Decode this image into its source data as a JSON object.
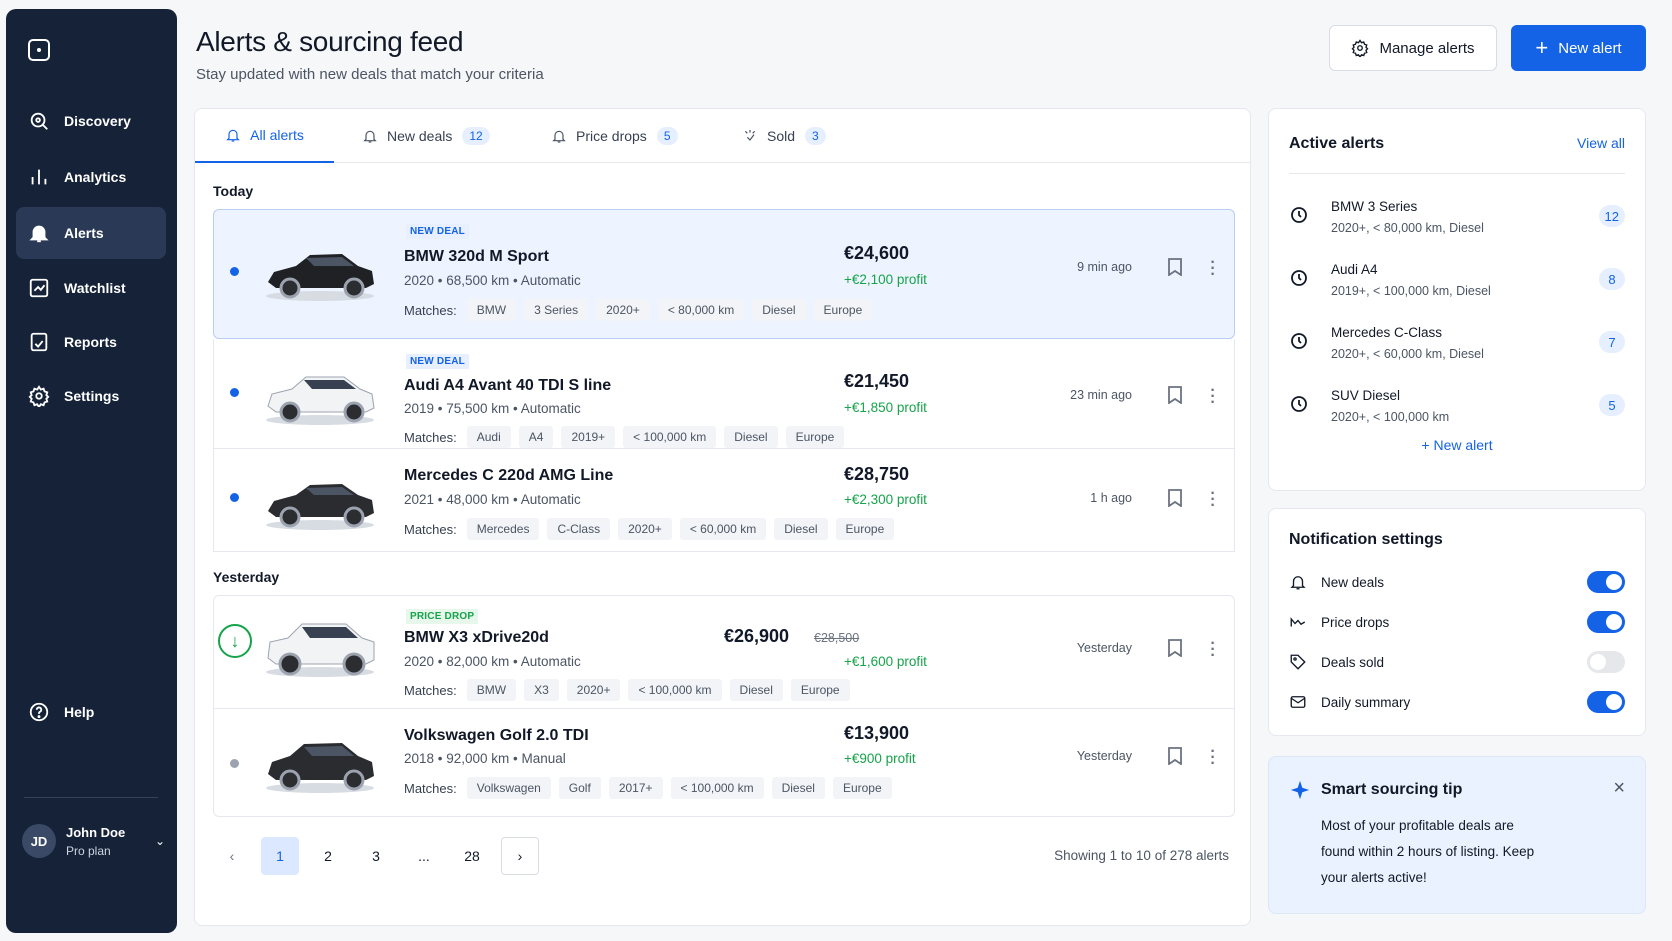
{
  "page": {
    "title": "Alerts & sourcing feed",
    "subtitle": "Stay updated with new deals that match your criteria",
    "manage_alerts": "Manage alerts",
    "new_alert": "New alert"
  },
  "sidebar": {
    "items": [
      {
        "label": "Discovery",
        "icon": "search-icon"
      },
      {
        "label": "Analytics",
        "icon": "bar-chart-icon"
      },
      {
        "label": "Alerts",
        "icon": "bell-icon",
        "active": true
      },
      {
        "label": "Watchlist",
        "icon": "chart-icon"
      },
      {
        "label": "Reports",
        "icon": "report-icon"
      },
      {
        "label": "Settings",
        "icon": "gear-icon"
      }
    ],
    "help": "Help",
    "user": {
      "initials": "JD",
      "name": "John Doe",
      "plan": "Pro plan"
    }
  },
  "tabs": [
    {
      "label": "All alerts",
      "badge": ""
    },
    {
      "label": "New deals",
      "badge": "12"
    },
    {
      "label": "Price drops",
      "badge": "5"
    },
    {
      "label": "Sold",
      "badge": "3"
    }
  ],
  "sections": {
    "today": "Today",
    "yesterday": "Yesterday"
  },
  "matches_label": "Matches:",
  "alerts": [
    {
      "tag": "NEW DEAL",
      "title": "BMW 320d M Sport",
      "meta": "2020 • 68,500 km • Automatic",
      "price": "€24,600",
      "old_price": "",
      "profit": "+€2,100 profit",
      "time": "9 min ago",
      "chips": [
        "BMW",
        "3 Series",
        "2020+",
        "< 80,000 km",
        "Diesel",
        "Europe"
      ]
    },
    {
      "tag": "NEW DEAL",
      "title": "Audi A4 Avant 40 TDI S line",
      "meta": "2019 • 75,500 km • Automatic",
      "price": "€21,450",
      "old_price": "",
      "profit": "+€1,850 profit",
      "time": "23 min ago",
      "chips": [
        "Audi",
        "A4",
        "2019+",
        "< 100,000 km",
        "Diesel",
        "Europe"
      ]
    },
    {
      "tag": "",
      "title": "Mercedes C 220d AMG Line",
      "meta": "2021 • 48,000 km • Automatic",
      "price": "€28,750",
      "old_price": "",
      "profit": "+€2,300 profit",
      "time": "1 h ago",
      "chips": [
        "Mercedes",
        "C-Class",
        "2020+",
        "< 60,000 km",
        "Diesel",
        "Europe"
      ]
    },
    {
      "tag": "PRICE DROP",
      "title": "BMW X3 xDrive20d",
      "meta": "2020 • 82,000 km • Automatic",
      "price": "€26,900",
      "old_price": "€28,500",
      "profit": "+€1,600 profit",
      "time": "Yesterday",
      "chips": [
        "BMW",
        "X3",
        "2020+",
        "< 100,000 km",
        "Diesel",
        "Europe"
      ]
    },
    {
      "tag": "",
      "title": "Volkswagen Golf 2.0 TDI",
      "meta": "2018 • 92,000 km • Manual",
      "price": "€13,900",
      "old_price": "",
      "profit": "+€900 profit",
      "time": "Yesterday",
      "chips": [
        "Volkswagen",
        "Golf",
        "2017+",
        "< 100,000 km",
        "Diesel",
        "Europe"
      ]
    }
  ],
  "pagination": {
    "pages": [
      "1",
      "2",
      "3",
      "...",
      "28"
    ],
    "showing": "Showing 1 to 10 of 278 alerts"
  },
  "active_alerts": {
    "title": "Active alerts",
    "view_all": "View all",
    "items": [
      {
        "name": "BMW 3 Series",
        "criteria": "2020+, < 80,000 km, Diesel",
        "count": "12"
      },
      {
        "name": "Audi A4",
        "criteria": "2019+, < 100,000 km, Diesel",
        "count": "8"
      },
      {
        "name": "Mercedes C-Class",
        "criteria": "2020+, < 60,000 km, Diesel",
        "count": "7"
      },
      {
        "name": "SUV Diesel",
        "criteria": "2020+, < 100,000 km",
        "count": "5"
      }
    ],
    "new_alert": "+ New alert"
  },
  "notifications": {
    "title": "Notification settings",
    "items": [
      {
        "label": "New deals",
        "on": true
      },
      {
        "label": "Price drops",
        "on": true
      },
      {
        "label": "Deals sold",
        "on": false
      },
      {
        "label": "Daily summary",
        "on": true
      }
    ]
  },
  "tip": {
    "title": "Smart sourcing tip",
    "text": "Most of your profitable deals are found within 2 hours of listing. Keep your alerts active!"
  },
  "colors": {
    "accent": "#1463e6",
    "sidebar": "#152238",
    "profit": "#16a34a"
  }
}
